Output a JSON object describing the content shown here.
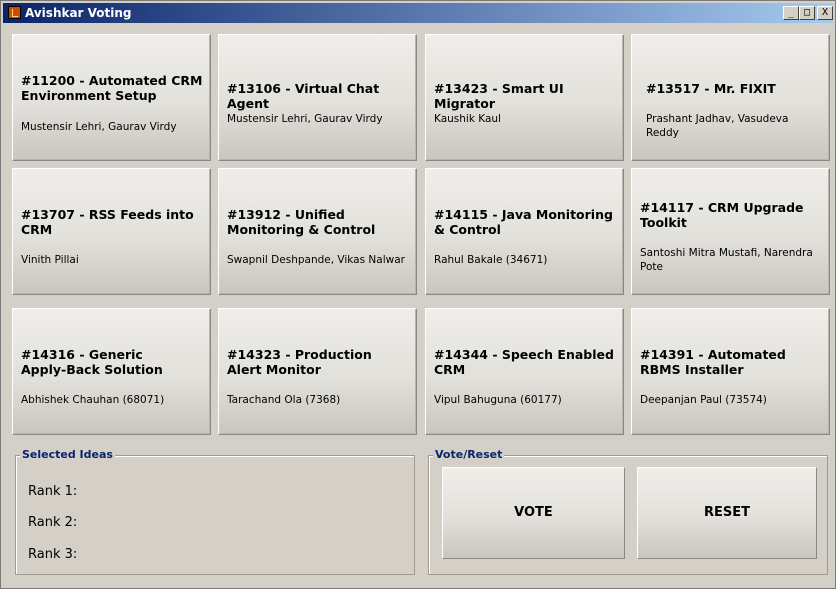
{
  "window": {
    "title": "Avishkar Voting",
    "controls": {
      "minimize": "_",
      "maximize": "□",
      "close": "X"
    }
  },
  "ideas": [
    {
      "title": "#11200 - Automated CRM Environment Setup",
      "members": "Mustensir Lehri, Gaurav Virdy"
    },
    {
      "title": "#13106 - Virtual Chat Agent",
      "members": "Mustensir Lehri, Gaurav Virdy"
    },
    {
      "title": "#13423 - Smart UI Migrator",
      "members": "Kaushik Kaul"
    },
    {
      "title": "#13517 - Mr. FIXIT",
      "members": "Prashant Jadhav, Vasudeva Reddy"
    },
    {
      "title": "#13707 - RSS Feeds into CRM",
      "members": "Vinith Pillai"
    },
    {
      "title": "#13912 - Unified Monitoring & Control",
      "members": "Swapnil Deshpande, Vikas Nalwar"
    },
    {
      "title": "#14115 - Java Monitoring & Control",
      "members": "Rahul Bakale (34671)"
    },
    {
      "title": "#14117 - CRM Upgrade Toolkit",
      "members": "Santoshi Mitra Mustafi, Narendra Pote"
    },
    {
      "title": "#14316 - Generic Apply-Back Solution",
      "members": "Abhishek Chauhan (68071)"
    },
    {
      "title": "#14323 - Production Alert Monitor",
      "members": "Tarachand Ola (7368)"
    },
    {
      "title": "#14344 - Speech Enabled CRM",
      "members": "Vipul Bahuguna (60177)"
    },
    {
      "title": "#14391 - Automated RBMS Installer",
      "members": "Deepanjan Paul (73574)"
    }
  ],
  "selected": {
    "legend": "Selected Ideas",
    "ranks": [
      "Rank 1:",
      "Rank 2:",
      "Rank 3:"
    ]
  },
  "actions": {
    "legend": "Vote/Reset",
    "vote_label": "VOTE",
    "reset_label": "RESET"
  }
}
